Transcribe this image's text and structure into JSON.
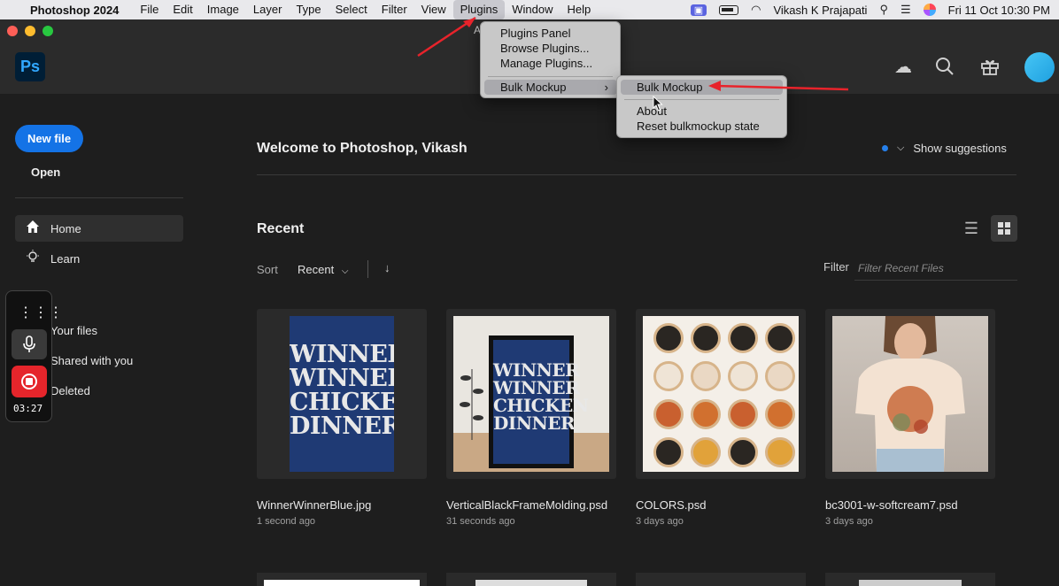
{
  "menubar": {
    "app_name": "Photoshop 2024",
    "menus": [
      "File",
      "Edit",
      "Image",
      "Layer",
      "Type",
      "Select",
      "Filter",
      "View",
      "Plugins",
      "Window",
      "Help"
    ],
    "active_menu": "Plugins",
    "user": "Vikash K Prajapati",
    "datetime": "Fri 11 Oct  10:30 PM"
  },
  "window": {
    "title": "A"
  },
  "header": {
    "logo": "Ps",
    "icons": [
      "cloud-icon",
      "search-icon",
      "gift-icon",
      "avatar"
    ]
  },
  "sidebar": {
    "new_file": "New file",
    "open": "Open",
    "items": [
      {
        "label": "Home",
        "icon": "home-icon",
        "active": true
      },
      {
        "label": "Learn",
        "icon": "lightbulb-icon",
        "active": false
      },
      {
        "label": "Your files",
        "icon": "",
        "active": false
      },
      {
        "label": "Shared with you",
        "icon": "",
        "active": false
      },
      {
        "label": "Deleted",
        "icon": "",
        "active": false
      }
    ]
  },
  "recorder": {
    "time": "03:27"
  },
  "main": {
    "welcome": "Welcome to Photoshop, Vikash",
    "show_suggestions": "Show suggestions",
    "recent_title": "Recent",
    "sort_label": "Sort",
    "sort_value": "Recent",
    "filter_label": "Filter",
    "filter_placeholder": "Filter Recent Files",
    "files": [
      {
        "name": "WinnerWinnerBlue.jpg",
        "time": "1 second ago"
      },
      {
        "name": "VerticalBlackFrameMolding.psd",
        "time": "31 seconds ago"
      },
      {
        "name": "COLORS.psd",
        "time": "3 days ago"
      },
      {
        "name": "bc3001-w-softcream7.psd",
        "time": "3 days ago"
      }
    ],
    "poster_text": [
      "WINNER",
      "WINNER",
      "CHICKEN",
      "DINNER"
    ]
  },
  "plugins_menu": {
    "items": [
      "Plugins Panel",
      "Browse Plugins...",
      "Manage Plugins..."
    ],
    "bulk_mockup": "Bulk Mockup",
    "submenu": [
      "Bulk Mockup",
      "About",
      "Reset bulkmockup state"
    ]
  },
  "colors": {
    "accent": "#1473e6",
    "annotation": "#e8232b",
    "poster_blue": "#1f3a74"
  }
}
